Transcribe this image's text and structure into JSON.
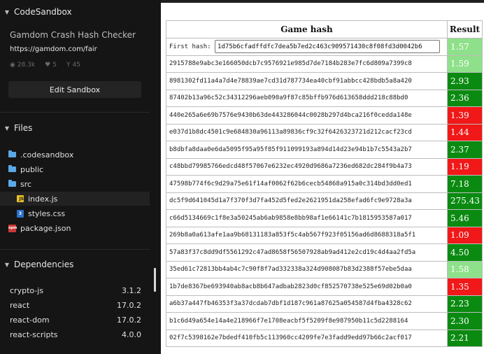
{
  "sidebar": {
    "codesandbox_label": "CodeSandbox",
    "project_title": "Gamdom Crash Hash Checker",
    "project_url": "https://gamdom.com/fair",
    "stats": {
      "views": "28.3k",
      "likes": "5",
      "forks": "45"
    },
    "edit_button": "Edit Sandbox",
    "files_label": "Files",
    "files": [
      {
        "name": ".codesandbox",
        "icon": "folder-icon"
      },
      {
        "name": "public",
        "icon": "folder-icon"
      },
      {
        "name": "src",
        "icon": "folder-icon"
      },
      {
        "name": "index.js",
        "icon": "js-file-icon"
      },
      {
        "name": "styles.css",
        "icon": "css-file-icon"
      },
      {
        "name": "package.json",
        "icon": "npm-package-icon"
      }
    ],
    "dependencies_label": "Dependencies",
    "dependencies": [
      {
        "name": "crypto-js",
        "version": "3.1.2"
      },
      {
        "name": "react",
        "version": "17.0.2"
      },
      {
        "name": "react-dom",
        "version": "17.0.2"
      },
      {
        "name": "react-scripts",
        "version": "4.0.0"
      }
    ]
  },
  "preview": {
    "header_hash": "Game hash",
    "header_result": "Result",
    "first_hash_label": "First hash:",
    "first_hash_value": "1d75b6cfadffdfc7dea5b7ed2c463c909571430c8f08fd3d0042b6",
    "first_result": "1.57",
    "rows": [
      {
        "hash": "2915788e9abc3e166050dcb7c9576921e985d7de7184b283e7fc6d809a7399c8",
        "result": "1.59"
      },
      {
        "hash": "8981302fd11a4a7d4e78839ae7cd31d787734ea40cbf91abbcc428bdb5a8a420",
        "result": "2.93"
      },
      {
        "hash": "87402b13a96c52c34312296aeb090a9f87c85bffb976d613658ddd218c88bd0",
        "result": "2.36"
      },
      {
        "hash": "440e265a6e69b7576e9430b63de443286044c0028b297d4bca216f0cedda148e",
        "result": "1.39"
      },
      {
        "hash": "e037d1b8dc4501c9e684830a96113a89836cf9c32f6426323721d212cacf23cd",
        "result": "1.44"
      },
      {
        "hash": "b8dbfa8daa0e6da5095f95a95f85f911099193a894d14d23e94b1b7c5543a2b7",
        "result": "2.37"
      },
      {
        "hash": "c48bbd79985766edcd48f57067e6232ec4920d9686a7236ed682dc284f9b4a73",
        "result": "1.19"
      },
      {
        "hash": "47598b774f6c9d29a75e61f14af0062f62b6cecb54868a915a0c314bd3dd0ed1",
        "result": "7.18"
      },
      {
        "hash": "dc5f9d641045d1a7f370f3d7fa452d5fed2e2621951da258efad6fc9e9728a3a",
        "result": "275.43"
      },
      {
        "hash": "c66d5134669c1f8e3a50245ab6ab9858e8bb98af1e66141c7b1815953587a017",
        "result": "5.46"
      },
      {
        "hash": "269b8a0a613afe1aa9b68131183a853f5c4ab567f923f05156ad6d8688318a5f1",
        "result": "1.09"
      },
      {
        "hash": "57a83f37c8dd9df5561292c47ad8658f56507928ab9ad412e2cd19c4d4aa2fd5a",
        "result": "4.50"
      },
      {
        "hash": "35ed61c72813bb4ab4c7c90f8f7ad332338a324d908087b83d2388f57ebe5daa",
        "result": "1.58"
      },
      {
        "hash": "1b7de8367be693940ab8acb8b647adbab2823d0cf852570738e525e69d02b0a0",
        "result": "1.35"
      },
      {
        "hash": "a6b37a447fb46353f3a37dcdab7dbf1d187c961a87625a054587d4fba4328c62",
        "result": "2.23"
      },
      {
        "hash": "b1c6d49a654e14a4e218966f7e1708eacbf5f5209f8e987950b11c5d2288164",
        "result": "2.30"
      },
      {
        "hash": "02f7c5398162e7bdedf410fb5c113960cc4209fe7e3fadd9edd97b66c2acf017",
        "result": "2.21"
      }
    ]
  },
  "colors": {
    "result_dark_green": "#0b8a12",
    "result_light_green": "#8fe08a",
    "result_red": "#f01818"
  }
}
